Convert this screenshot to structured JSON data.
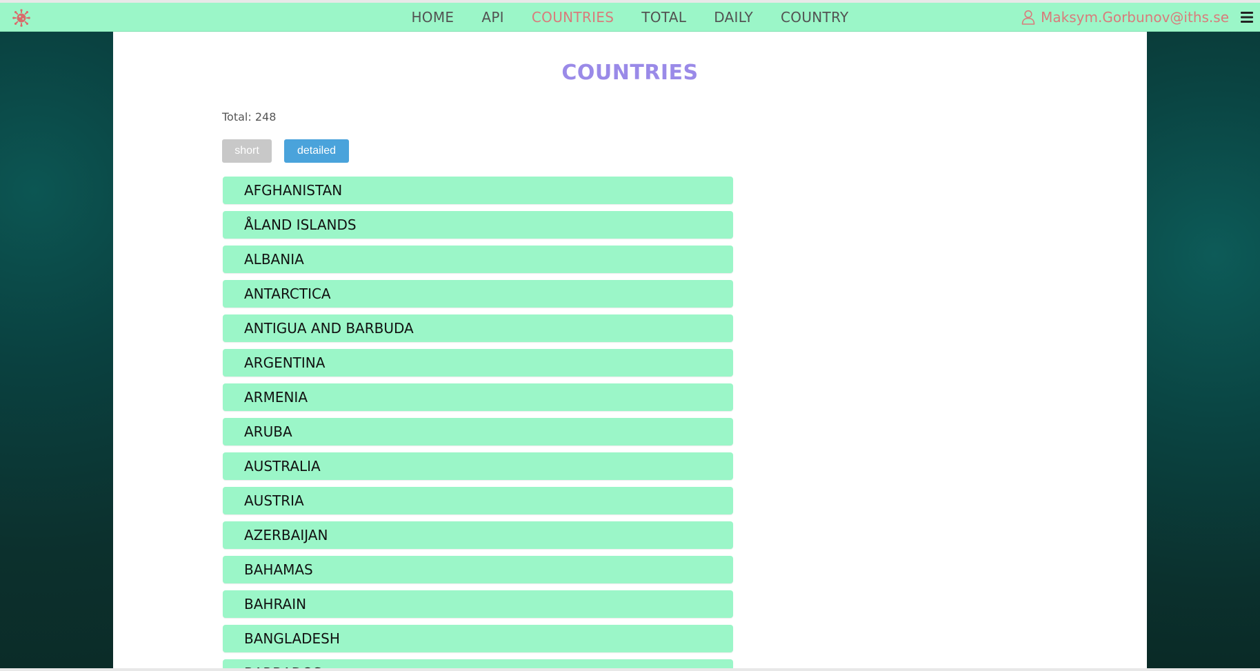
{
  "colors": {
    "navbar_bg": "#9bf6c8",
    "nav_text": "#525252",
    "nav_active": "#d97b7b",
    "title": "#9a8ae8",
    "item_bg": "#9bf6c8",
    "btn_short": "#c8c8c8",
    "btn_detailed": "#4aa3db"
  },
  "navbar": {
    "logo_icon": "virus-icon",
    "links": [
      {
        "label": "HOME",
        "active": false
      },
      {
        "label": "API",
        "active": false
      },
      {
        "label": "COUNTRIES",
        "active": true
      },
      {
        "label": "TOTAL",
        "active": false
      },
      {
        "label": "DAILY",
        "active": false
      },
      {
        "label": "COUNTRY",
        "active": false
      }
    ],
    "user_email": "Maksym.Gorbunov@iths.se",
    "user_icon": "user-icon",
    "menu_icon": "hamburger-menu-icon"
  },
  "main": {
    "title": "COUNTRIES",
    "total_text": "Total: 248",
    "buttons": {
      "short_label": "short",
      "detailed_label": "detailed"
    },
    "countries": [
      "AFGHANISTAN",
      "ÅLAND ISLANDS",
      "ALBANIA",
      "ANTARCTICA",
      "ANTIGUA AND BARBUDA",
      "ARGENTINA",
      "ARMENIA",
      "ARUBA",
      "AUSTRALIA",
      "AUSTRIA",
      "AZERBAIJAN",
      "BAHAMAS",
      "BAHRAIN",
      "BANGLADESH",
      "BARBADOS"
    ]
  }
}
